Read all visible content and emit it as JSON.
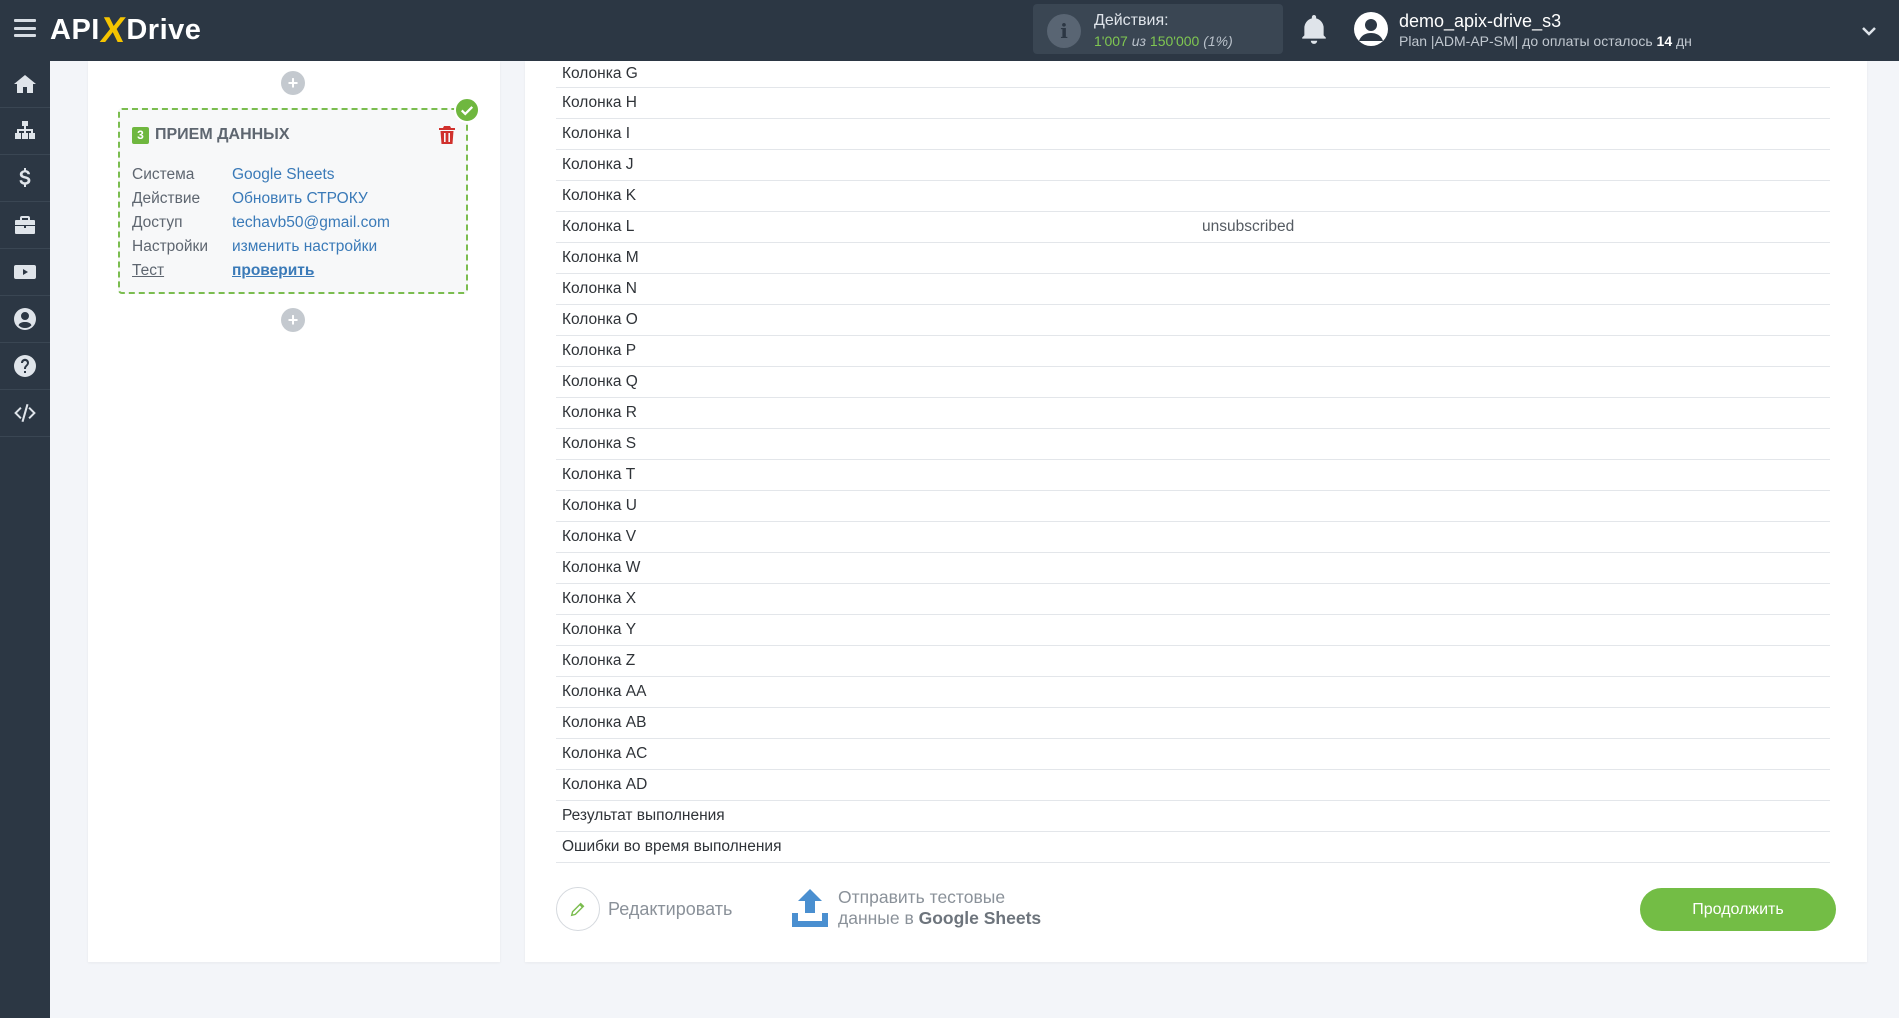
{
  "brand": {
    "logo_left": "API",
    "logo_x": "X",
    "logo_right": "Drive"
  },
  "actions": {
    "title": "Действия:",
    "used": "1'007",
    "of": "из",
    "total": "150'000",
    "percent": "(1%)"
  },
  "user": {
    "name": "demo_apix-drive_s3",
    "plan_prefix": "Plan |ADM-AP-SM| до оплаты осталось",
    "days": "14",
    "days_suffix": "дн"
  },
  "sidebar": {
    "items": [
      {
        "icon": "home-icon"
      },
      {
        "icon": "sitemap-icon"
      },
      {
        "icon": "dollar-icon"
      },
      {
        "icon": "briefcase-icon"
      },
      {
        "icon": "video-icon"
      },
      {
        "icon": "user-icon"
      },
      {
        "icon": "help-icon"
      },
      {
        "icon": "code-icon"
      }
    ]
  },
  "step": {
    "number": "3",
    "title": "ПРИЕМ ДАННЫХ",
    "rows": [
      {
        "key": "Система",
        "value": "Google Sheets"
      },
      {
        "key": "Действие",
        "value": "Обновить СТРОКУ"
      },
      {
        "key": "Доступ",
        "value": "techavb50@gmail.com"
      },
      {
        "key": "Настройки",
        "value": "изменить настройки"
      },
      {
        "key": "Тест",
        "value": "проверить"
      }
    ]
  },
  "columns": [
    {
      "label": "Колонка G",
      "value": ""
    },
    {
      "label": "Колонка H",
      "value": ""
    },
    {
      "label": "Колонка I",
      "value": ""
    },
    {
      "label": "Колонка J",
      "value": ""
    },
    {
      "label": "Колонка K",
      "value": ""
    },
    {
      "label": "Колонка L",
      "value": "unsubscribed"
    },
    {
      "label": "Колонка M",
      "value": ""
    },
    {
      "label": "Колонка N",
      "value": ""
    },
    {
      "label": "Колонка O",
      "value": ""
    },
    {
      "label": "Колонка P",
      "value": ""
    },
    {
      "label": "Колонка Q",
      "value": ""
    },
    {
      "label": "Колонка R",
      "value": ""
    },
    {
      "label": "Колонка S",
      "value": ""
    },
    {
      "label": "Колонка T",
      "value": ""
    },
    {
      "label": "Колонка U",
      "value": ""
    },
    {
      "label": "Колонка V",
      "value": ""
    },
    {
      "label": "Колонка W",
      "value": ""
    },
    {
      "label": "Колонка X",
      "value": ""
    },
    {
      "label": "Колонка Y",
      "value": ""
    },
    {
      "label": "Колонка Z",
      "value": ""
    },
    {
      "label": "Колонка AA",
      "value": ""
    },
    {
      "label": "Колонка AB",
      "value": ""
    },
    {
      "label": "Колонка AC",
      "value": ""
    },
    {
      "label": "Колонка AD",
      "value": ""
    },
    {
      "label": "Результат выполнения",
      "value": ""
    },
    {
      "label": "Ошибки во время выполнения",
      "value": ""
    }
  ],
  "footer": {
    "edit_label": "Редактировать",
    "send_line1": "Отправить тестовые",
    "send_line2_prefix": "данные в",
    "send_line2_bold": "Google Sheets",
    "continue_label": "Продолжить"
  },
  "colors": {
    "accent_green": "#73bd45",
    "topbar": "#2c3744",
    "link_blue": "#3a7ab8",
    "trash_red": "#d0312d"
  }
}
